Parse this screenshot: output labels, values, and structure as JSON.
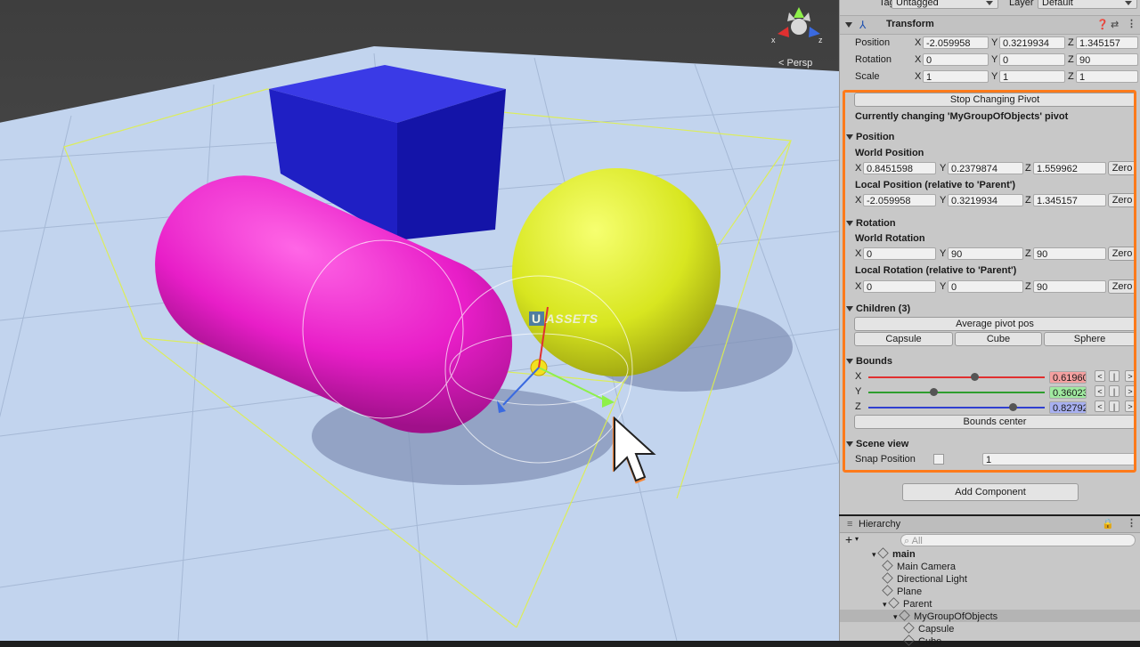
{
  "scene": {
    "view_mode": "< Persp",
    "watermark_u": "U",
    "watermark_text": "ASSETS"
  },
  "inspector": {
    "tag_label": "Tag",
    "tag_value": "Untagged",
    "layer_label": "Layer",
    "layer_value": "Default",
    "transform": {
      "title": "Transform",
      "position": {
        "label": "Position",
        "x": "-2.059958",
        "y": "0.3219934",
        "z": "1.345157"
      },
      "rotation": {
        "label": "Rotation",
        "x": "0",
        "y": "0",
        "z": "90"
      },
      "scale": {
        "label": "Scale",
        "x": "1",
        "y": "1",
        "z": "1"
      }
    },
    "pivot": {
      "stop_button": "Stop Changing Pivot",
      "status": "Currently changing 'MyGroupOfObjects' pivot",
      "position_header": "Position",
      "world_position_label": "World Position",
      "world_position": {
        "x": "0.8451598",
        "y": "0.2379874",
        "z": "1.559962"
      },
      "local_position_label": "Local Position (relative to 'Parent')",
      "local_position": {
        "x": "-2.059958",
        "y": "0.3219934",
        "z": "1.345157"
      },
      "rotation_header": "Rotation",
      "world_rotation_label": "World Rotation",
      "world_rotation": {
        "x": "0",
        "y": "90",
        "z": "90"
      },
      "local_rotation_label": "Local Rotation (relative to 'Parent')",
      "local_rotation": {
        "x": "0",
        "y": "0",
        "z": "90"
      },
      "zero": "Zero",
      "children_header": "Children (3)",
      "average_button": "Average pivot pos",
      "children": [
        "Capsule",
        "Cube",
        "Sphere"
      ],
      "bounds_header": "Bounds",
      "bounds": [
        {
          "axis": "X",
          "value": "0.61960",
          "fraction": 0.6,
          "color": "#e03030",
          "box": "#f4a0a0"
        },
        {
          "axis": "Y",
          "value": "0.36023",
          "fraction": 0.37,
          "color": "#2e9e2e",
          "box": "#a0eaa0"
        },
        {
          "axis": "Z",
          "value": "0.82792",
          "fraction": 0.82,
          "color": "#3040d0",
          "box": "#a8b0f0"
        }
      ],
      "bounds_center": "Bounds center",
      "scene_view_header": "Scene view",
      "snap_label": "Snap Position",
      "snap_value": "1",
      "step_prev": "<",
      "step_mid": "|",
      "step_next": ">"
    },
    "add_component": "Add Component",
    "axis_x": "X",
    "axis_y": "Y",
    "axis_z": "Z"
  },
  "hierarchy": {
    "title": "Hierarchy",
    "search_placeholder": "All",
    "items": [
      {
        "label": "main",
        "depth": 0
      },
      {
        "label": "Main Camera",
        "depth": 1
      },
      {
        "label": "Directional Light",
        "depth": 1
      },
      {
        "label": "Plane",
        "depth": 1
      },
      {
        "label": "Parent",
        "depth": 1
      },
      {
        "label": "MyGroupOfObjects",
        "depth": 2
      },
      {
        "label": "Capsule",
        "depth": 3
      },
      {
        "label": "Cube",
        "depth": 3
      }
    ]
  }
}
